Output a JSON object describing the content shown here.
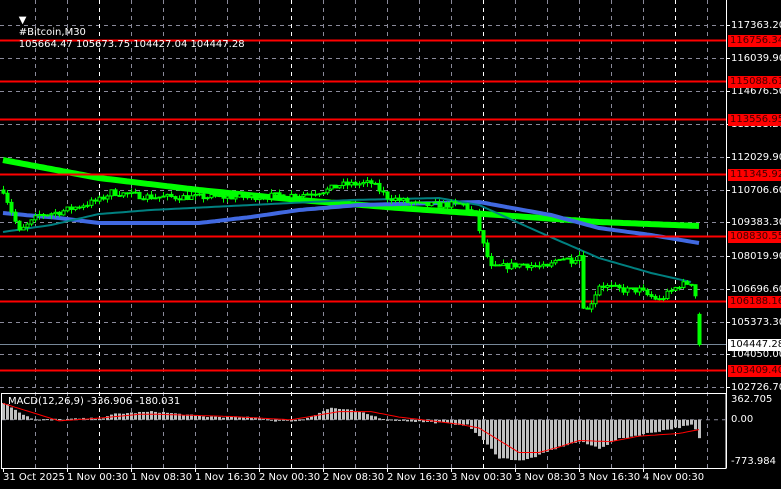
{
  "header": {
    "menu_icon": "triangle-down-icon",
    "symbol": "#Bitcoin,M30",
    "ohlc": "105664.47 105673.75 104427.04 104447.28"
  },
  "chart_data": {
    "type": "candlestick",
    "title": "#Bitcoin,M30",
    "last_ohlc": {
      "open": 105664.47,
      "high": 105673.75,
      "low": 104427.04,
      "close": 104447.28
    },
    "bar_count": 175,
    "price_axis": {
      "range": [
        102726.7,
        117363.2
      ],
      "ticks": [
        "117363.20",
        "116039.90",
        "114676.50",
        "113353.20",
        "112029.90",
        "110706.60",
        "109383.30",
        "108019.90",
        "106696.60",
        "105373.30",
        "104050.00",
        "102726.70"
      ]
    },
    "time_axis": {
      "ticks": [
        "31 Oct 2025",
        "1 Nov 00:30",
        "1 Nov 08:30",
        "1 Nov 16:30",
        "2 Nov 00:30",
        "2 Nov 08:30",
        "2 Nov 16:30",
        "3 Nov 00:30",
        "3 Nov 08:30",
        "3 Nov 16:30",
        "4 Nov 00:30"
      ],
      "bars_per_tick": 16
    },
    "price_path": [
      [
        0,
        110692
      ],
      [
        4,
        108994
      ],
      [
        9,
        109681
      ],
      [
        14,
        109800
      ],
      [
        24,
        110288
      ],
      [
        27,
        110600
      ],
      [
        37,
        110410
      ],
      [
        60,
        110409
      ],
      [
        74,
        110500
      ],
      [
        81,
        110692
      ],
      [
        84,
        110894
      ],
      [
        92,
        110975
      ],
      [
        96,
        110409
      ],
      [
        104,
        110086
      ],
      [
        115,
        110100
      ],
      [
        118,
        109681
      ],
      [
        120,
        108469
      ],
      [
        122,
        107539
      ],
      [
        130,
        107700
      ],
      [
        136,
        107539
      ],
      [
        139,
        107983
      ],
      [
        142,
        107862
      ],
      [
        144,
        108064
      ],
      [
        145,
        106043
      ],
      [
        146,
        105841
      ],
      [
        149,
        106852
      ],
      [
        155,
        106649
      ],
      [
        159,
        106649
      ],
      [
        161,
        106447
      ],
      [
        164,
        106245
      ],
      [
        169,
        106852
      ],
      [
        172,
        106952
      ],
      [
        173,
        106447
      ],
      [
        174,
        104447.28
      ]
    ],
    "horizontal_levels": [
      "116756.34",
      "115088.61",
      "113556.95",
      "111345.92",
      "108830.55",
      "106188.16",
      "103409.40"
    ],
    "current_price": "104447.28",
    "moving_averages": [
      {
        "name": "MA slow",
        "color": "#00ff00",
        "points": [
          [
            0,
            111905
          ],
          [
            24,
            111177
          ],
          [
            49,
            110692
          ],
          [
            74,
            110288
          ],
          [
            99,
            109964
          ],
          [
            124,
            109681
          ],
          [
            149,
            109398
          ],
          [
            174,
            109237
          ]
        ]
      },
      {
        "name": "MA mid",
        "color": "#4169e1",
        "points": [
          [
            0,
            109762
          ],
          [
            14,
            109560
          ],
          [
            24,
            109358
          ],
          [
            49,
            109358
          ],
          [
            62,
            109601
          ],
          [
            74,
            109883
          ],
          [
            89,
            110086
          ],
          [
            119,
            110207
          ],
          [
            137,
            109681
          ],
          [
            149,
            109156
          ],
          [
            162,
            108873
          ],
          [
            174,
            108549
          ]
        ]
      },
      {
        "name": "MA fast",
        "color": "#008080",
        "points": [
          [
            0,
            108994
          ],
          [
            12,
            109277
          ],
          [
            24,
            109722
          ],
          [
            37,
            109883
          ],
          [
            62,
            110086
          ],
          [
            87,
            110288
          ],
          [
            109,
            110369
          ],
          [
            119,
            110086
          ],
          [
            134,
            108994
          ],
          [
            149,
            107943
          ],
          [
            162,
            107337
          ],
          [
            172,
            106973
          ]
        ]
      }
    ],
    "macd": {
      "label": "MACD(12,26,9) -336.906 -180.031",
      "params": [
        12,
        26,
        9
      ],
      "main": -336.906,
      "signal": -180.031,
      "axis": {
        "max": "362.705",
        "zero": "0.00",
        "min": "-773.984"
      },
      "histogram": [
        [
          0,
          320
        ],
        [
          5,
          100
        ],
        [
          8,
          0
        ],
        [
          15,
          10
        ],
        [
          25,
          30
        ],
        [
          28,
          110
        ],
        [
          38,
          150
        ],
        [
          50,
          60
        ],
        [
          64,
          40
        ],
        [
          68,
          -20
        ],
        [
          74,
          -20
        ],
        [
          82,
          220
        ],
        [
          88,
          160
        ],
        [
          96,
          0
        ],
        [
          110,
          -60
        ],
        [
          116,
          -100
        ],
        [
          119,
          -300
        ],
        [
          124,
          -700
        ],
        [
          130,
          -750
        ],
        [
          134,
          -650
        ],
        [
          139,
          -500
        ],
        [
          144,
          -400
        ],
        [
          149,
          -520
        ],
        [
          154,
          -350
        ],
        [
          161,
          -250
        ],
        [
          168,
          -150
        ],
        [
          172,
          -100
        ],
        [
          173,
          -180
        ],
        [
          174,
          -336.906
        ]
      ],
      "signal_line": [
        [
          0,
          300
        ],
        [
          14,
          -20
        ],
        [
          24,
          30
        ],
        [
          34,
          100
        ],
        [
          39,
          100
        ],
        [
          57,
          60
        ],
        [
          72,
          0
        ],
        [
          84,
          150
        ],
        [
          92,
          150
        ],
        [
          99,
          50
        ],
        [
          114,
          -80
        ],
        [
          119,
          -150
        ],
        [
          129,
          -600
        ],
        [
          134,
          -600
        ],
        [
          139,
          -500
        ],
        [
          144,
          -380
        ],
        [
          152,
          -400
        ],
        [
          159,
          -300
        ],
        [
          169,
          -250
        ],
        [
          174,
          -180.031
        ]
      ]
    }
  }
}
